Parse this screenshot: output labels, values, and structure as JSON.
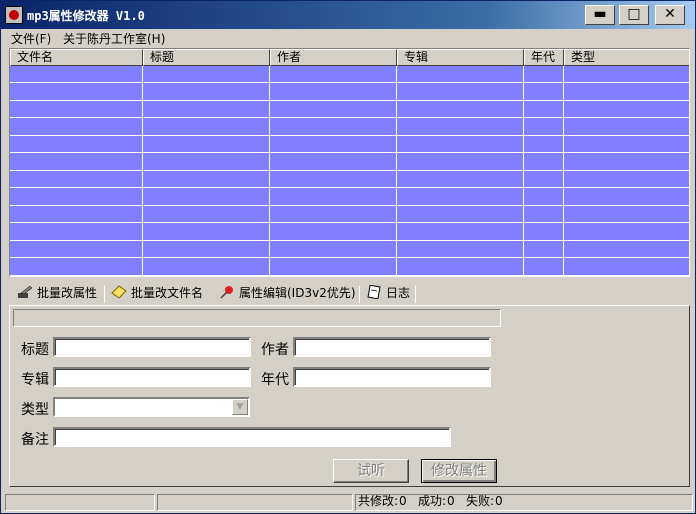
{
  "window": {
    "title": "mp3属性修改器 V1.0",
    "controls": {
      "minimize": "▬",
      "maximize": "□",
      "close": "✕"
    }
  },
  "menu": [
    {
      "label": "文件(F)"
    },
    {
      "label": "关于陈丹工作室(H)"
    }
  ],
  "list": {
    "columns": [
      "文件名",
      "标题",
      "作者",
      "专辑",
      "年代",
      "类型"
    ],
    "row_count": 12,
    "background": "#8080ff"
  },
  "tabs": [
    {
      "label": "批量改属性",
      "icon": "edit-icon"
    },
    {
      "label": "批量改文件名",
      "icon": "eraser-icon"
    },
    {
      "label": "属性编辑(ID3v2优先)",
      "icon": "pin-icon",
      "active": true
    },
    {
      "label": "日志",
      "icon": "notebook-icon"
    }
  ],
  "form": {
    "title_label": "标题",
    "title_value": "",
    "author_label": "作者",
    "author_value": "",
    "album_label": "专辑",
    "album_value": "",
    "year_label": "年代",
    "year_value": "",
    "genre_label": "类型",
    "genre_value": "",
    "note_label": "备注",
    "note_value": ""
  },
  "buttons": {
    "listen": "试听",
    "modify": "修改属性"
  },
  "status": {
    "total_label": "共修改:",
    "total_value": "0",
    "success_label": "成功:",
    "success_value": "0",
    "fail_label": "失败:",
    "fail_value": "0"
  }
}
